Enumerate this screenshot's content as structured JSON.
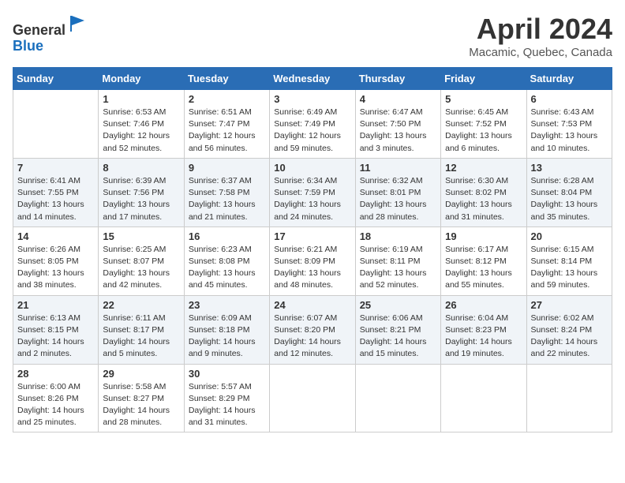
{
  "header": {
    "logo_line1": "General",
    "logo_line2": "Blue",
    "month_title": "April 2024",
    "location": "Macamic, Quebec, Canada"
  },
  "weekdays": [
    "Sunday",
    "Monday",
    "Tuesday",
    "Wednesday",
    "Thursday",
    "Friday",
    "Saturday"
  ],
  "weeks": [
    [
      {
        "day": "",
        "info": ""
      },
      {
        "day": "1",
        "info": "Sunrise: 6:53 AM\nSunset: 7:46 PM\nDaylight: 12 hours\nand 52 minutes."
      },
      {
        "day": "2",
        "info": "Sunrise: 6:51 AM\nSunset: 7:47 PM\nDaylight: 12 hours\nand 56 minutes."
      },
      {
        "day": "3",
        "info": "Sunrise: 6:49 AM\nSunset: 7:49 PM\nDaylight: 12 hours\nand 59 minutes."
      },
      {
        "day": "4",
        "info": "Sunrise: 6:47 AM\nSunset: 7:50 PM\nDaylight: 13 hours\nand 3 minutes."
      },
      {
        "day": "5",
        "info": "Sunrise: 6:45 AM\nSunset: 7:52 PM\nDaylight: 13 hours\nand 6 minutes."
      },
      {
        "day": "6",
        "info": "Sunrise: 6:43 AM\nSunset: 7:53 PM\nDaylight: 13 hours\nand 10 minutes."
      }
    ],
    [
      {
        "day": "7",
        "info": "Sunrise: 6:41 AM\nSunset: 7:55 PM\nDaylight: 13 hours\nand 14 minutes."
      },
      {
        "day": "8",
        "info": "Sunrise: 6:39 AM\nSunset: 7:56 PM\nDaylight: 13 hours\nand 17 minutes."
      },
      {
        "day": "9",
        "info": "Sunrise: 6:37 AM\nSunset: 7:58 PM\nDaylight: 13 hours\nand 21 minutes."
      },
      {
        "day": "10",
        "info": "Sunrise: 6:34 AM\nSunset: 7:59 PM\nDaylight: 13 hours\nand 24 minutes."
      },
      {
        "day": "11",
        "info": "Sunrise: 6:32 AM\nSunset: 8:01 PM\nDaylight: 13 hours\nand 28 minutes."
      },
      {
        "day": "12",
        "info": "Sunrise: 6:30 AM\nSunset: 8:02 PM\nDaylight: 13 hours\nand 31 minutes."
      },
      {
        "day": "13",
        "info": "Sunrise: 6:28 AM\nSunset: 8:04 PM\nDaylight: 13 hours\nand 35 minutes."
      }
    ],
    [
      {
        "day": "14",
        "info": "Sunrise: 6:26 AM\nSunset: 8:05 PM\nDaylight: 13 hours\nand 38 minutes."
      },
      {
        "day": "15",
        "info": "Sunrise: 6:25 AM\nSunset: 8:07 PM\nDaylight: 13 hours\nand 42 minutes."
      },
      {
        "day": "16",
        "info": "Sunrise: 6:23 AM\nSunset: 8:08 PM\nDaylight: 13 hours\nand 45 minutes."
      },
      {
        "day": "17",
        "info": "Sunrise: 6:21 AM\nSunset: 8:09 PM\nDaylight: 13 hours\nand 48 minutes."
      },
      {
        "day": "18",
        "info": "Sunrise: 6:19 AM\nSunset: 8:11 PM\nDaylight: 13 hours\nand 52 minutes."
      },
      {
        "day": "19",
        "info": "Sunrise: 6:17 AM\nSunset: 8:12 PM\nDaylight: 13 hours\nand 55 minutes."
      },
      {
        "day": "20",
        "info": "Sunrise: 6:15 AM\nSunset: 8:14 PM\nDaylight: 13 hours\nand 59 minutes."
      }
    ],
    [
      {
        "day": "21",
        "info": "Sunrise: 6:13 AM\nSunset: 8:15 PM\nDaylight: 14 hours\nand 2 minutes."
      },
      {
        "day": "22",
        "info": "Sunrise: 6:11 AM\nSunset: 8:17 PM\nDaylight: 14 hours\nand 5 minutes."
      },
      {
        "day": "23",
        "info": "Sunrise: 6:09 AM\nSunset: 8:18 PM\nDaylight: 14 hours\nand 9 minutes."
      },
      {
        "day": "24",
        "info": "Sunrise: 6:07 AM\nSunset: 8:20 PM\nDaylight: 14 hours\nand 12 minutes."
      },
      {
        "day": "25",
        "info": "Sunrise: 6:06 AM\nSunset: 8:21 PM\nDaylight: 14 hours\nand 15 minutes."
      },
      {
        "day": "26",
        "info": "Sunrise: 6:04 AM\nSunset: 8:23 PM\nDaylight: 14 hours\nand 19 minutes."
      },
      {
        "day": "27",
        "info": "Sunrise: 6:02 AM\nSunset: 8:24 PM\nDaylight: 14 hours\nand 22 minutes."
      }
    ],
    [
      {
        "day": "28",
        "info": "Sunrise: 6:00 AM\nSunset: 8:26 PM\nDaylight: 14 hours\nand 25 minutes."
      },
      {
        "day": "29",
        "info": "Sunrise: 5:58 AM\nSunset: 8:27 PM\nDaylight: 14 hours\nand 28 minutes."
      },
      {
        "day": "30",
        "info": "Sunrise: 5:57 AM\nSunset: 8:29 PM\nDaylight: 14 hours\nand 31 minutes."
      },
      {
        "day": "",
        "info": ""
      },
      {
        "day": "",
        "info": ""
      },
      {
        "day": "",
        "info": ""
      },
      {
        "day": "",
        "info": ""
      }
    ]
  ]
}
